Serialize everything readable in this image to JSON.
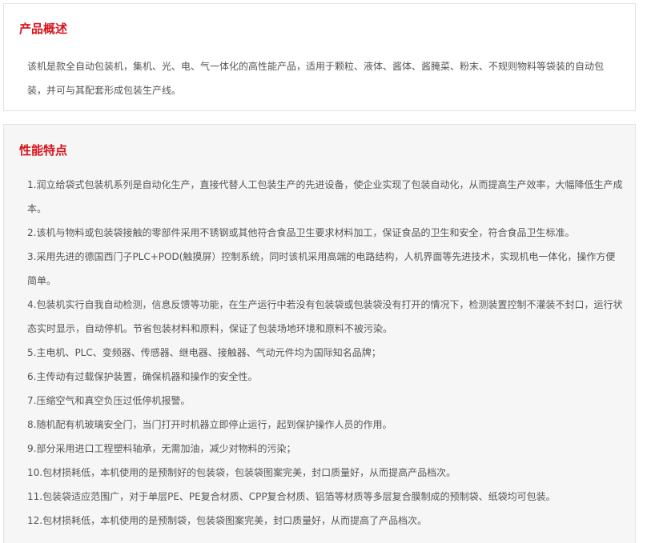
{
  "overview": {
    "title": "产品概述",
    "text": "该机是款全自动包装机，集机、光、电、气一体化的高性能产品，适用于颗粒、液体、酱体、酱腌菜、粉末、不规则物料等袋装的自动包装，并可与其配套形成包装生产线。"
  },
  "features": {
    "title": "性能特点",
    "items": [
      "1.润立给袋式包装机系列是自动化生产，直接代替人工包装生产的先进设备，使企业实现了包装自动化，从而提高生产效率，大幅降低生产成本。",
      "2.该机与物料或包装袋接触的零部件采用不锈钢或其他符合食品卫生要求材料加工，保证食品的卫生和安全，符合食品卫生标准。",
      "3.采用先进的德国西门子PLC+POD(触摸屏）控制系统，同时该机采用高端的电路结构，人机界面等先进技术，实现机电一体化，操作方便简单。",
      "4.包装机实行自我自动检测，信息反馈等功能，在生产运行中若没有包装袋或包装袋没有打开的情况下，检测装置控制不灌装不封口，运行状态实时显示，自动停机。节省包装材料和原料，保证了包装场地环境和原料不被污染。",
      "5.主电机、PLC、变频器、传感器、继电器、接触器、气动元件均为国际知名品牌；",
      "6.主传动有过载保护装置，确保机器和操作的安全性。",
      "7.压缩空气和真空负压过低停机报警。",
      "8.随机配有机玻璃安全门，当门打开时机器立即停止运行，起到保护操作人员的作用。",
      "9.部分采用进口工程塑料轴承，无需加油，减少对物料的污染；",
      "10.包材损耗低，本机使用的是预制好的包装袋，包装袋图案完美，封口质量好，从而提高产品档次。",
      "11.包装袋适应范围广，对于单层PE、PE复合材质、CPP复合材质、铝箔等材质等多层复合膜制成的预制袋、纸袋均可包装。",
      "12.包材损耗低，本机使用的是预制袋，包装袋图案完美，封口质量好，从而提高了产品档次。"
    ]
  }
}
